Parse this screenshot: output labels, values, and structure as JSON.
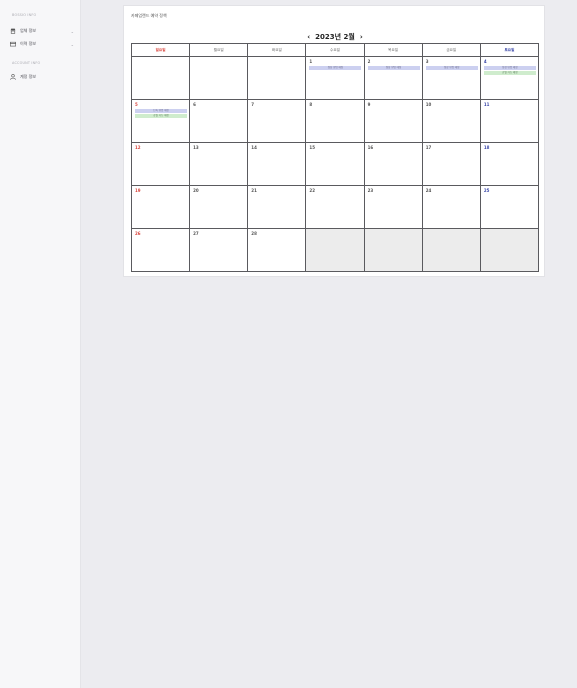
{
  "sidebar": {
    "section1_label": "BOSSIO INFO",
    "items1": [
      {
        "label": "업체 정보",
        "icon": "store-icon"
      },
      {
        "label": "이력 정보",
        "icon": "card-icon"
      }
    ],
    "section2_label": "ACCOUNT INFO",
    "items2": [
      {
        "label": "계정 정보",
        "icon": "person-icon"
      }
    ]
  },
  "calendar": {
    "card_title": "카페업랜드 예약 정책",
    "month_title": "2023년 2월",
    "weekdays": [
      "일요일",
      "월요일",
      "화요일",
      "수요일",
      "목요일",
      "금요일",
      "토요일"
    ],
    "weeks": [
      [
        {
          "day": ""
        },
        {
          "day": ""
        },
        {
          "day": ""
        },
        {
          "day": "1",
          "events": [
            {
              "text": "정상 영업 예정",
              "color": "purple"
            }
          ]
        },
        {
          "day": "2",
          "events": [
            {
              "text": "정상 영업 예정",
              "color": "purple"
            }
          ]
        },
        {
          "day": "3",
          "events": [
            {
              "text": "정상 영업 예정",
              "color": "purple"
            }
          ]
        },
        {
          "day": "4",
          "events": [
            {
              "text": "정상 영업 예정",
              "color": "purple"
            },
            {
              "text": "휴일 가능 예정",
              "color": "green"
            }
          ]
        }
      ],
      [
        {
          "day": "5",
          "events": [
            {
              "text": "단축 영업 예정",
              "color": "purple"
            },
            {
              "text": "휴일 가능 예정",
              "color": "green"
            }
          ]
        },
        {
          "day": "6"
        },
        {
          "day": "7"
        },
        {
          "day": "8"
        },
        {
          "day": "9"
        },
        {
          "day": "10"
        },
        {
          "day": "11"
        }
      ],
      [
        {
          "day": "12"
        },
        {
          "day": "13"
        },
        {
          "day": "14"
        },
        {
          "day": "15"
        },
        {
          "day": "16"
        },
        {
          "day": "17"
        },
        {
          "day": "18"
        }
      ],
      [
        {
          "day": "19"
        },
        {
          "day": "20"
        },
        {
          "day": "21"
        },
        {
          "day": "22"
        },
        {
          "day": "23"
        },
        {
          "day": "24"
        },
        {
          "day": "25"
        }
      ],
      [
        {
          "day": "26"
        },
        {
          "day": "27"
        },
        {
          "day": "28"
        },
        {
          "day": "",
          "empty": true
        },
        {
          "day": "",
          "empty": true
        },
        {
          "day": "",
          "empty": true
        },
        {
          "day": "",
          "empty": true
        }
      ]
    ]
  }
}
